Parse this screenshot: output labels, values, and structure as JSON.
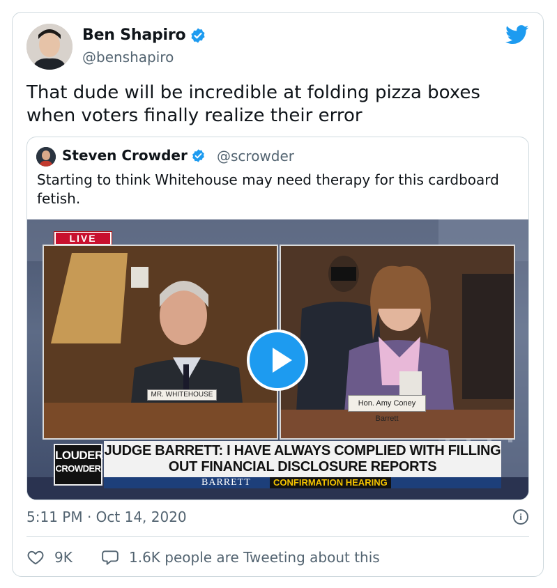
{
  "author": {
    "name": "Ben Shapiro",
    "handle": "@benshapiro",
    "verified": true,
    "avatar_icon": "user-avatar"
  },
  "tweet": {
    "text": "That dude will be incredible at folding pizza boxes when voters finally realize their error",
    "timestamp": "5:11 PM · Oct 14, 2020"
  },
  "quoted_tweet": {
    "name": "Steven Crowder",
    "handle": "@scrowder",
    "verified": true,
    "text": "Starting to think Whitehouse may need therapy for this cardboard fetish.",
    "media": {
      "live_badge": "LIVE",
      "left_nameplate": "MR. WHITEHOUSE",
      "right_nameplate": "Hon. Amy Coney Barrett",
      "headline": "JUDGE BARRETT: I HAVE ALWAYS COMPLIED WITH FILLING OUT FINANCIAL DISCLOSURE REPORTS",
      "lower_third_left": "BARRETT",
      "lower_third_right": "CONFIRMATION HEARING",
      "logo_top": "LOUDER",
      "logo_bottom": "CROWDER",
      "play_icon": "play-icon"
    }
  },
  "stats": {
    "likes": "9K",
    "tweeting": "1.6K people are Tweeting about this"
  },
  "colors": {
    "twitter_blue": "#1d9bf0",
    "secondary_text": "#536471",
    "border": "#cfd9de"
  }
}
